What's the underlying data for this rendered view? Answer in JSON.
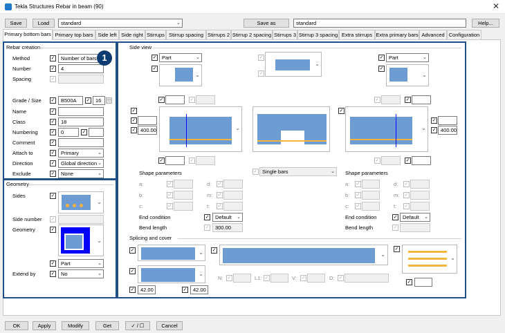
{
  "window": {
    "title": "Tekla Structures  Rebar in beam (90)"
  },
  "toolbar": {
    "save": "Save",
    "load": "Load",
    "load_value": "standard",
    "save_as": "Save as",
    "save_as_value": "standard",
    "help": "Help..."
  },
  "tabs": [
    "Primary bottom bars",
    "Primary top bars",
    "Side left",
    "Side right",
    "Stirrups",
    "Stirrup spacing",
    "Stirrups 2",
    "Stirrup 2 spacing",
    "Stirrups 3",
    "Stirrup 3 spacing",
    "Extra stirrups",
    "Extra primary bars",
    "Advanced",
    "Configuration"
  ],
  "badge": "1",
  "rebar_creation": {
    "title": "Rebar creation",
    "method_label": "Method",
    "method_value": "Number of bars",
    "number_label": "Number",
    "number_value": "4",
    "spacing_label": "Spacing",
    "grade_label": "Grade / Size",
    "grade_value": "B500A",
    "size_value": "16",
    "size_btn": "...",
    "name_label": "Name",
    "class_label": "Class",
    "class_value": "18",
    "numbering_label": "Numbering",
    "numbering_value": "0",
    "comment_label": "Comment",
    "attach_label": "Attach to",
    "attach_value": "Primary",
    "direction_label": "Direction",
    "direction_value": "Global direction",
    "exclude_label": "Exclude",
    "exclude_value": "None"
  },
  "geometry": {
    "title": "Geometry",
    "sides_label": "Sides",
    "side_number_label": "Side number",
    "geometry_label": "Geometry",
    "geometry_value": "Part",
    "extend_label": "Extend by",
    "extend_value": "No"
  },
  "side_view": {
    "title": "Side view",
    "left_part": "Part",
    "right_part": "Part",
    "left_value": "400.00",
    "right_value": "400.00",
    "single_bars": "Single bars",
    "shape_params": "Shape parameters",
    "a": "a:",
    "b": "b:",
    "c": "c:",
    "d": "d:",
    "m": "m:",
    "t": "t:",
    "end_condition_label": "End condition",
    "end_condition_value": "Default",
    "bend_length_label": "Bend length",
    "bend_length_value": "300.00",
    "right_end_condition_value": "Default"
  },
  "splicing": {
    "title": "Splicing and cover",
    "v1": "42.00",
    "v2": "42.00",
    "n": "N:",
    "l1": "L1:",
    "v": "V:",
    "d": "D:"
  },
  "bottom": {
    "ok": "OK",
    "apply": "Apply",
    "modify": "Modify",
    "get": "Get",
    "toggle": "✓ / ☐",
    "cancel": "Cancel"
  }
}
